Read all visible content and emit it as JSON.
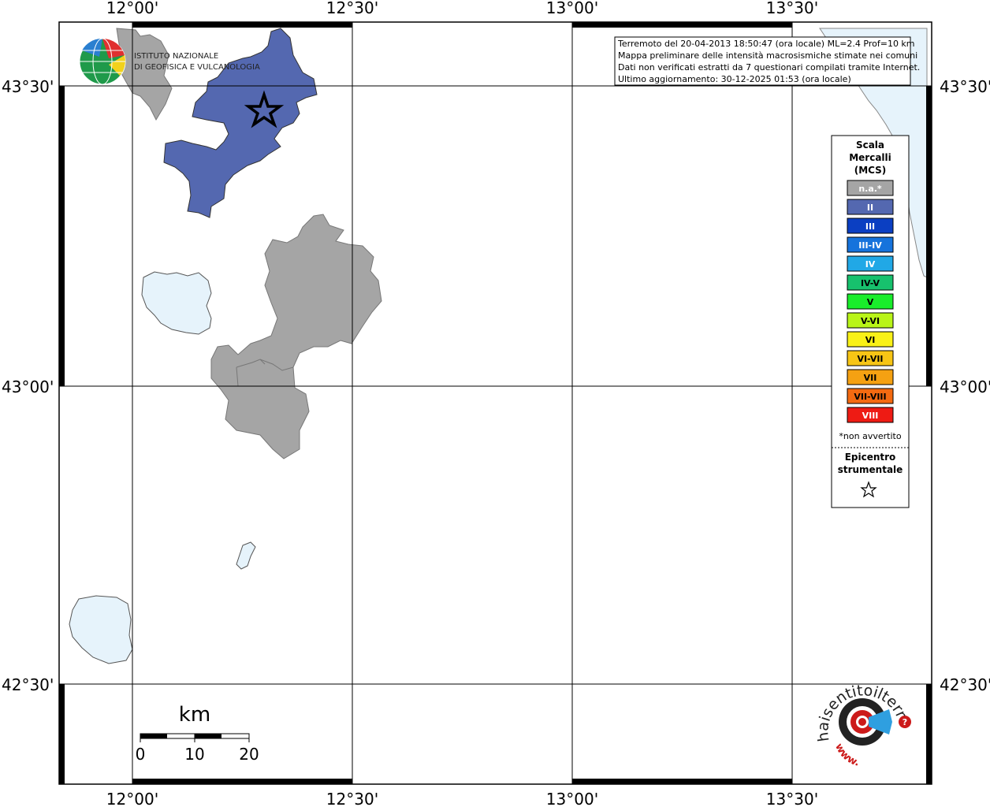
{
  "axes": {
    "lon_ticks": [
      "12°00'",
      "12°30'",
      "13°00'",
      "13°30'"
    ],
    "lat_ticks": [
      "43°30'",
      "43°00'",
      "42°30'"
    ]
  },
  "logo_ingv": {
    "line1": "ISTITUTO NAZIONALE",
    "line2": "DI GEOFISICA E VULCANOLOGIA"
  },
  "info_box": {
    "line1": "Terremoto del 20-04-2013 18:50:47 (ora locale) ML=2.4 Prof=10 km",
    "line2": "Mappa preliminare delle intensità macrosismiche stimate nei comuni",
    "line3": "Dati non verificati estratti da 7 questionari compilati tramite Internet.",
    "line4": "Ultimo aggiornamento: 30-12-2025 01:53 (ora locale)"
  },
  "legend": {
    "title1": "Scala",
    "title2": "Mercalli",
    "title3": "(MCS)",
    "items": [
      {
        "label": "n.a.*",
        "color": "#a5a5a5",
        "text_color": "#ffffff"
      },
      {
        "label": "II",
        "color": "#5468b0",
        "text_color": "#ffffff"
      },
      {
        "label": "III",
        "color": "#0b3fc2",
        "text_color": "#ffffff"
      },
      {
        "label": "III-IV",
        "color": "#1673dc",
        "text_color": "#ffffff"
      },
      {
        "label": "IV",
        "color": "#21a8e6",
        "text_color": "#ffffff"
      },
      {
        "label": "IV-V",
        "color": "#17c16d",
        "text_color": "#000000"
      },
      {
        "label": "V",
        "color": "#19ed2b",
        "text_color": "#000000"
      },
      {
        "label": "V-VI",
        "color": "#b9f518",
        "text_color": "#000000"
      },
      {
        "label": "VI",
        "color": "#f9f117",
        "text_color": "#000000"
      },
      {
        "label": "VI-VII",
        "color": "#f7c515",
        "text_color": "#000000"
      },
      {
        "label": "VII",
        "color": "#f5a112",
        "text_color": "#000000"
      },
      {
        "label": "VII-VIII",
        "color": "#f46a11",
        "text_color": "#000000"
      },
      {
        "label": "VIII",
        "color": "#ee1b14",
        "text_color": "#ffffff"
      }
    ],
    "footnote": "*non avvertito",
    "epicenter_title1": "Epicentro",
    "epicenter_title2": "strumentale"
  },
  "scale_bar": {
    "unit": "km",
    "labels": [
      "0",
      "10",
      "20"
    ]
  },
  "site_logo": {
    "text": "haisentitoilterremoto.it",
    "prefix": "www."
  },
  "colors": {
    "water": "#e6f3fb",
    "felt_II": "#5468b0",
    "not_felt": "#a5a5a5"
  }
}
